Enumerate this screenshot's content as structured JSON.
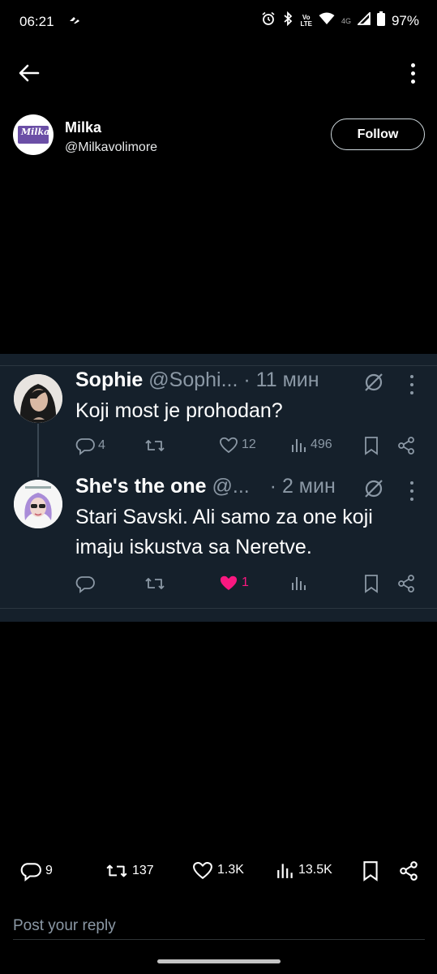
{
  "status_bar": {
    "time": "06:21",
    "network_label": "4G",
    "volte_top": "Vo",
    "volte_bottom": "LTE",
    "battery": "97%",
    "icons": [
      "alarm-icon",
      "bluetooth-icon",
      "volte-icon",
      "wifi-icon",
      "signal-icon",
      "battery-icon"
    ]
  },
  "header": {
    "back_icon": "arrow-left-icon",
    "more_icon": "more-vertical-icon"
  },
  "profile": {
    "name": "Milka",
    "handle": "@Milkavolimore",
    "follow_label": "Follow",
    "avatar_text": "Milka",
    "brand_color": "#6b4fa6"
  },
  "thread": {
    "tweets": [
      {
        "name": "Sophie",
        "handle": "@Sophi...",
        "time": "· 11 мин",
        "text": "Koji most je prohodan?",
        "replies": "4",
        "retweets": "",
        "likes": "12",
        "views": "496",
        "liked": false
      },
      {
        "name": "She's the one",
        "handle": "@...",
        "time": "· 2 мин",
        "text": "Stari Savski. Ali samo za one koji imaju iskustva sa Neretve.",
        "replies": "",
        "retweets": "",
        "likes": "1",
        "views": "",
        "liked": true
      }
    ],
    "card_bg": "#15202b",
    "like_active_color": "#f91880"
  },
  "post_stats": {
    "replies": "9",
    "retweets": "137",
    "likes": "1.3K",
    "views": "13.5K"
  },
  "reply": {
    "placeholder": "Post your reply"
  }
}
